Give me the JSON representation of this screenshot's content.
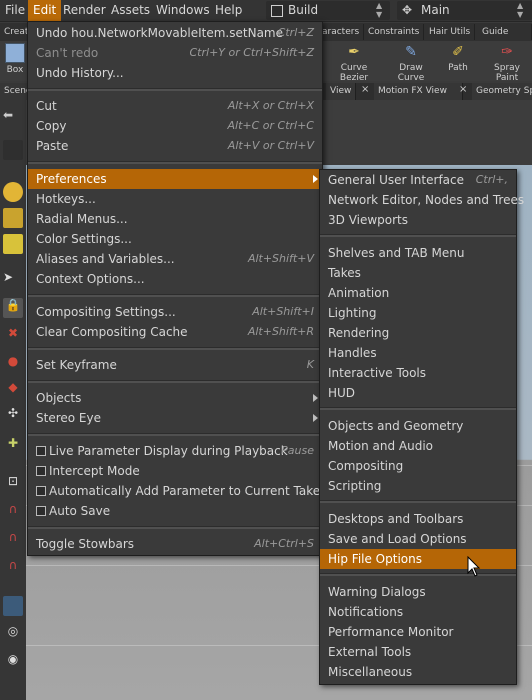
{
  "menubar": {
    "items": [
      "File",
      "Edit",
      "Render",
      "Assets",
      "Windows",
      "Help"
    ],
    "build_label": "Build",
    "desktop_label": "Main"
  },
  "shelf_tabs": [
    "Create",
    "aracters",
    "Constraints",
    "Hair Utils",
    "Guide Proces"
  ],
  "shelf_tools": [
    "Box",
    "Curve Bezier",
    "Draw Curve",
    "Path",
    "Spray Paint"
  ],
  "pane_tabs": [
    "Scene",
    "View",
    "Motion FX View",
    "Geometry Sp"
  ],
  "edit_menu": {
    "items": [
      {
        "label": "Undo hou.NetworkMovableItem.setName",
        "shortcut": "Ctrl+Z"
      },
      {
        "label": "Can't redo",
        "shortcut": "Ctrl+Y or Ctrl+Shift+Z",
        "disabled": true
      },
      {
        "label": "Undo History...",
        "shortcut": ""
      },
      {
        "label": "Cut",
        "shortcut": "Alt+X or Ctrl+X"
      },
      {
        "label": "Copy",
        "shortcut": "Alt+C or Ctrl+C"
      },
      {
        "label": "Paste",
        "shortcut": "Alt+V or Ctrl+V"
      },
      {
        "label": "Preferences",
        "shortcut": "",
        "submenu": true,
        "highlighted": true
      },
      {
        "label": "Hotkeys...",
        "shortcut": ""
      },
      {
        "label": "Radial Menus...",
        "shortcut": ""
      },
      {
        "label": "Color Settings...",
        "shortcut": ""
      },
      {
        "label": "Aliases and Variables...",
        "shortcut": "Alt+Shift+V"
      },
      {
        "label": "Context Options...",
        "shortcut": ""
      },
      {
        "label": "Compositing Settings...",
        "shortcut": "Alt+Shift+I"
      },
      {
        "label": "Clear Compositing Cache",
        "shortcut": "Alt+Shift+R"
      },
      {
        "label": "Set Keyframe",
        "shortcut": "K"
      },
      {
        "label": "Objects",
        "shortcut": "",
        "submenu": true
      },
      {
        "label": "Stereo Eye",
        "shortcut": "",
        "submenu": true
      },
      {
        "label": "Live Parameter Display during Playback",
        "shortcut": "Pause",
        "checkbox": true
      },
      {
        "label": "Intercept Mode",
        "shortcut": "",
        "checkbox": true
      },
      {
        "label": "Automatically Add Parameter to Current Take",
        "shortcut": "",
        "checkbox": true
      },
      {
        "label": "Auto Save",
        "shortcut": "",
        "checkbox": true
      },
      {
        "label": "Toggle Stowbars",
        "shortcut": "Alt+Ctrl+S"
      }
    ]
  },
  "preferences_menu": {
    "items": [
      {
        "label": "General User Interface",
        "shortcut": "Ctrl+,"
      },
      {
        "label": "Network Editor, Nodes and Trees",
        "shortcut": ""
      },
      {
        "label": "3D Viewports",
        "shortcut": ""
      },
      {
        "label": "Shelves and TAB Menu",
        "shortcut": ""
      },
      {
        "label": "Takes",
        "shortcut": ""
      },
      {
        "label": "Animation",
        "shortcut": ""
      },
      {
        "label": "Lighting",
        "shortcut": ""
      },
      {
        "label": "Rendering",
        "shortcut": ""
      },
      {
        "label": "Handles",
        "shortcut": ""
      },
      {
        "label": "Interactive Tools",
        "shortcut": ""
      },
      {
        "label": "HUD",
        "shortcut": ""
      },
      {
        "label": "Objects and Geometry",
        "shortcut": ""
      },
      {
        "label": "Motion and Audio",
        "shortcut": ""
      },
      {
        "label": "Compositing",
        "shortcut": ""
      },
      {
        "label": "Scripting",
        "shortcut": ""
      },
      {
        "label": "Desktops and Toolbars",
        "shortcut": ""
      },
      {
        "label": "Save and Load Options",
        "shortcut": ""
      },
      {
        "label": "Hip File Options",
        "shortcut": "",
        "highlighted": true
      },
      {
        "label": "Warning Dialogs",
        "shortcut": ""
      },
      {
        "label": "Notifications",
        "shortcut": ""
      },
      {
        "label": "Performance Monitor",
        "shortcut": ""
      },
      {
        "label": "External Tools",
        "shortcut": ""
      },
      {
        "label": "Miscellaneous",
        "shortcut": ""
      }
    ]
  },
  "colors": {
    "highlight": "#b56606",
    "menu_bg": "#3a3a3a"
  }
}
